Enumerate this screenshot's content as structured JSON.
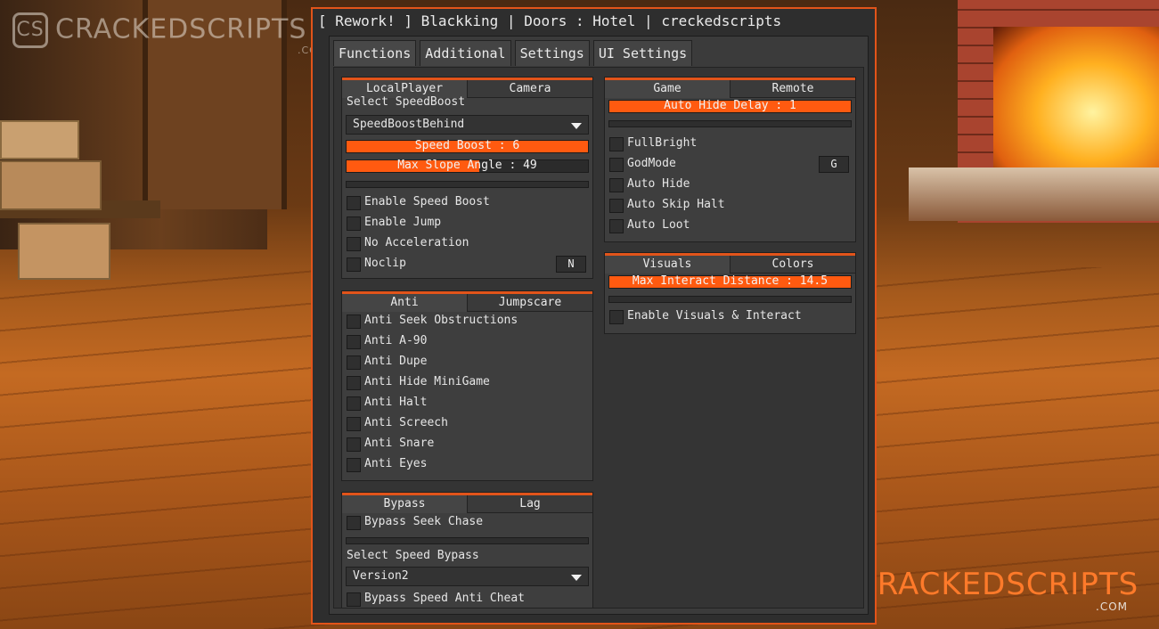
{
  "watermark": {
    "brand": "CRACKEDSCRIPTS",
    "com": ".COM",
    "logo": "CS"
  },
  "window": {
    "title": "[ Rework! ] Blackking | Doors : Hotel | creckedscripts"
  },
  "tabs": [
    "Functions",
    "Additional",
    "Settings",
    "UI Settings"
  ],
  "player_group": {
    "tabs": [
      "LocalPlayer",
      "Camera"
    ],
    "select_label": "Select SpeedBoost",
    "select_value": "SpeedBoostBehind",
    "sliders": [
      {
        "label": "Speed Boost : 6",
        "fill": 1.0
      },
      {
        "label": "Max Slope Angle : 49",
        "fill": 0.55
      }
    ],
    "toggles": [
      "Enable Speed Boost",
      "Enable Jump",
      "No Acceleration",
      "Noclip"
    ],
    "noclip_key": "N"
  },
  "anti_group": {
    "tabs": [
      "Anti",
      "Jumpscare"
    ],
    "toggles": [
      "Anti Seek Obstructions",
      "Anti A-90",
      "Anti Dupe",
      "Anti Hide MiniGame",
      "Anti Halt",
      "Anti Screech",
      "Anti Snare",
      "Anti Eyes"
    ]
  },
  "bypass_group": {
    "tabs": [
      "Bypass",
      "Lag"
    ],
    "toggle1": "Bypass Seek Chase",
    "select_label": "Select Speed Bypass",
    "select_value": "Version2",
    "toggle2": "Bypass Speed Anti Cheat"
  },
  "game_group": {
    "tabs": [
      "Game",
      "Remote"
    ],
    "slider": {
      "label": "Auto Hide Delay : 1",
      "fill": 1.0
    },
    "toggles": [
      "FullBright",
      "GodMode",
      "Auto Hide",
      "Auto Skip Halt",
      "Auto Loot"
    ],
    "godmode_key": "G"
  },
  "visuals_group": {
    "tabs": [
      "Visuals",
      "Colors"
    ],
    "slider": {
      "label": "Max Interact Distance : 14.5",
      "fill": 1.0
    },
    "toggle": "Enable Visuals & Interact"
  },
  "colors": {
    "accent": "#e2541a",
    "slider_fill": "#ff5a10"
  }
}
